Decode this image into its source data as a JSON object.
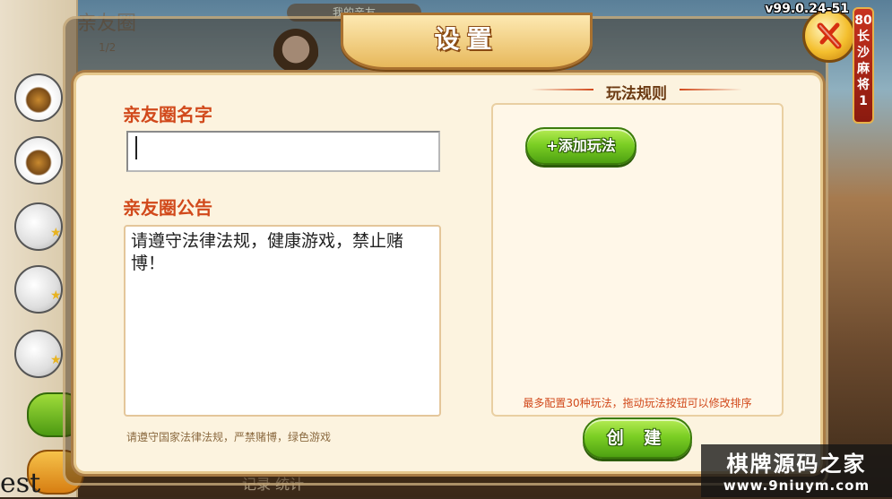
{
  "background": {
    "left_panel_title": "亲友圈",
    "left_panel_count": "1/2",
    "top_tab": "我的亲友",
    "bottom_tabs": "记录   统计",
    "test_text": "est",
    "version": "v99.0.24-51",
    "vertical_tag": "80长沙麻将1"
  },
  "dialog": {
    "title": "设置",
    "name_section": {
      "label": "亲友圈名字",
      "value": ""
    },
    "announcement_section": {
      "label": "亲友圈公告",
      "value": "请遵守法律法规，健康游戏，禁止赌博！"
    },
    "left_hint": "请遵守国家法律法规，严禁赌博，绿色游戏",
    "rules": {
      "header": "玩法规则",
      "add_button": "+添加玩法",
      "hint": "最多配置30种玩法，拖动玩法按钮可以修改排序"
    },
    "create_button": "创 建"
  },
  "watermark": {
    "line1": "棋牌源码之家",
    "line2": "www.9niuym.com"
  },
  "colors": {
    "label_orange": "#d1491b",
    "green_button": "#7ccf24",
    "dialog_bg": "#fcf3df"
  },
  "icons": {
    "close": "close-x-icon"
  }
}
